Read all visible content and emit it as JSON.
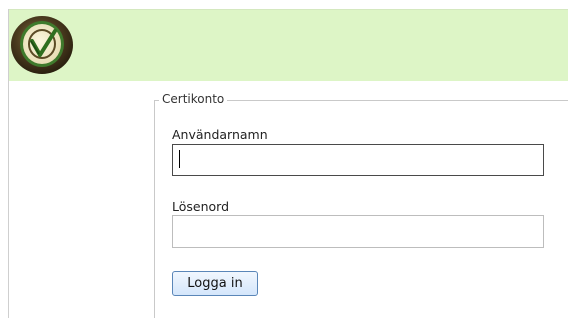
{
  "header": {
    "logo_icon": "certificate-check-icon",
    "background_color": "#ddf5c6"
  },
  "login_form": {
    "legend": "Certikonto",
    "username_label": "Användarnamn",
    "username_value": "",
    "password_label": "Lösenord",
    "password_value": "",
    "login_button_label": "Logga in"
  }
}
